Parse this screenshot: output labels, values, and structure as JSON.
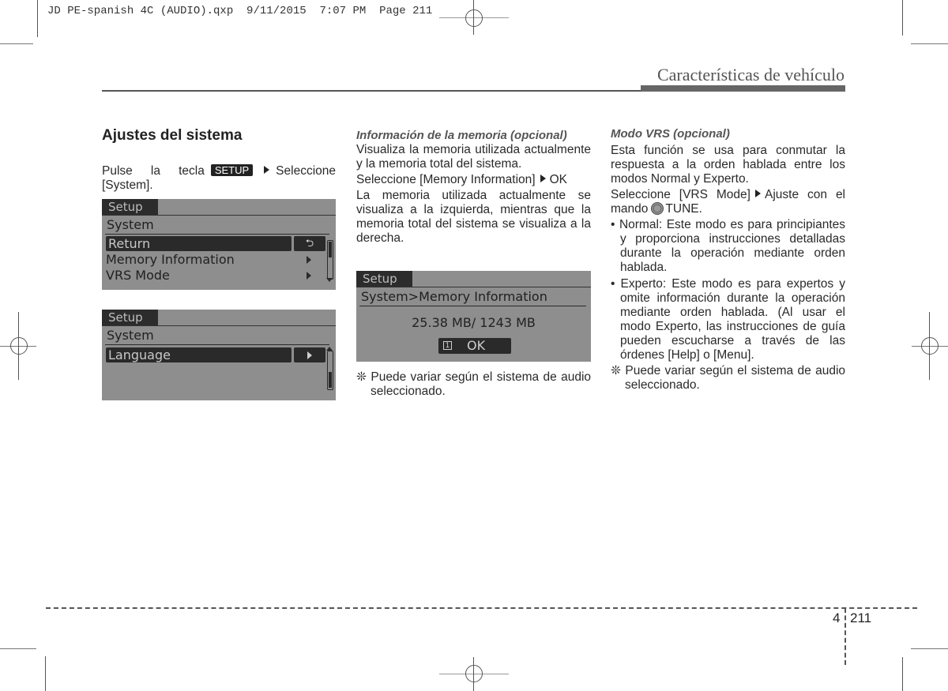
{
  "slug": "JD PE-spanish 4C (AUDIO).qxp  9/11/2015  7:07 PM  Page 211",
  "header": {
    "chapter_title": "Características de vehículo"
  },
  "col1": {
    "title": "Ajustes del sistema",
    "instr_before": "Pulse la tecla",
    "setup_key": "SETUP",
    "instr_after": "Seleccione [System].",
    "screen1": {
      "tab": "Setup",
      "crumb": "System",
      "rows": [
        {
          "label": "Return",
          "selected": true,
          "control": "return-icon"
        },
        {
          "label": "Memory Information",
          "selected": false,
          "control": "chevron-right-icon"
        },
        {
          "label": "VRS Mode",
          "selected": false,
          "control": "chevron-right-icon"
        }
      ],
      "return_glyph": "⮌"
    },
    "screen2": {
      "tab": "Setup",
      "crumb": "System",
      "rows": [
        {
          "label": "Language",
          "selected": true,
          "control": "chevron-right-icon"
        }
      ]
    }
  },
  "col2": {
    "subtitle": "Información de la memoria (opcional)",
    "p1": "Visualiza la memoria utilizada actualmente y la memoria total del sistema.",
    "p2_before": "Seleccione [Memory Information]",
    "p2_after": "OK",
    "p3": "La memoria utilizada actualmente se visualiza a la izquierda, mientras que la memoria total del sistema se visualiza a la derecha.",
    "screen": {
      "tab": "Setup",
      "crumb": "System>Memory Information",
      "memory_value": "25.38 MB/ 1243 MB",
      "ok_key": "1",
      "ok_label": "OK"
    },
    "note_mark": "❊",
    "note": "Puede variar según el sistema de audio seleccionado."
  },
  "col3": {
    "subtitle": "Modo VRS (opcional)",
    "p1": "Esta función se usa para conmutar la respuesta a la orden hablada entre los modos Normal y Experto.",
    "p2_before": "Seleccione [VRS Mode]",
    "p2_mid": "Ajuste con el mando",
    "p2_after": "TUNE.",
    "bullets": [
      "• Normal: Este modo es para principiantes y proporciona instrucciones detalladas durante la operación mediante orden hablada.",
      "• Experto: Este modo es para expertos y omite información durante la operación mediante orden hablada. (Al usar el modo Experto, las instrucciones de guía pueden escucharse a través de las órdenes [Help] o [Menu]."
    ],
    "note_mark": "❊",
    "note": "Puede variar según el sistema de audio seleccionado."
  },
  "footer": {
    "chapter": "4",
    "page": "211"
  }
}
